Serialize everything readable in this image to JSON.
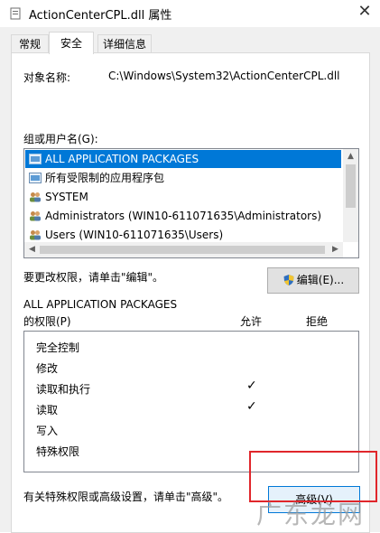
{
  "window": {
    "title": "ActionCenterCPL.dll 属性",
    "close_glyph": "✕"
  },
  "tabs": [
    {
      "label": "常规",
      "active": false
    },
    {
      "label": "安全",
      "active": true
    },
    {
      "label": "详细信息",
      "active": false
    }
  ],
  "object": {
    "label": "对象名称:",
    "value": "C:\\Windows\\System32\\ActionCenterCPL.dll"
  },
  "groups": {
    "label": "组或用户名(G):",
    "items": [
      {
        "name": "ALL APPLICATION PACKAGES",
        "icon": "app-package-icon",
        "selected": true
      },
      {
        "name": "所有受限制的应用程序包",
        "icon": "app-package-icon",
        "selected": false
      },
      {
        "name": "SYSTEM",
        "icon": "users-group-icon",
        "selected": false
      },
      {
        "name": "Administrators (WIN10-611071635\\Administrators)",
        "icon": "users-group-icon",
        "selected": false
      },
      {
        "name": "Users (WIN10-611071635\\Users)",
        "icon": "users-group-icon",
        "selected": false
      }
    ]
  },
  "edit": {
    "hint": "要更改权限，请单击\"编辑\"。",
    "button_label": "编辑(E)..."
  },
  "permissions": {
    "for_name": "ALL APPLICATION PACKAGES",
    "for_label": "的权限(P)",
    "allow_header": "允许",
    "deny_header": "拒绝",
    "rows": [
      {
        "label": "完全控制",
        "allow": false,
        "deny": false
      },
      {
        "label": "修改",
        "allow": false,
        "deny": false
      },
      {
        "label": "读取和执行",
        "allow": true,
        "deny": false
      },
      {
        "label": "读取",
        "allow": true,
        "deny": false
      },
      {
        "label": "写入",
        "allow": false,
        "deny": false
      },
      {
        "label": "特殊权限",
        "allow": false,
        "deny": false
      }
    ],
    "check_glyph": "✓"
  },
  "advanced": {
    "hint": "有关特殊权限或高级设置，请单击\"高级\"。",
    "button_label": "高级(V)"
  },
  "watermark": "广东龙网",
  "colors": {
    "selection": "#0078d7",
    "highlight_box": "#e0262b"
  }
}
